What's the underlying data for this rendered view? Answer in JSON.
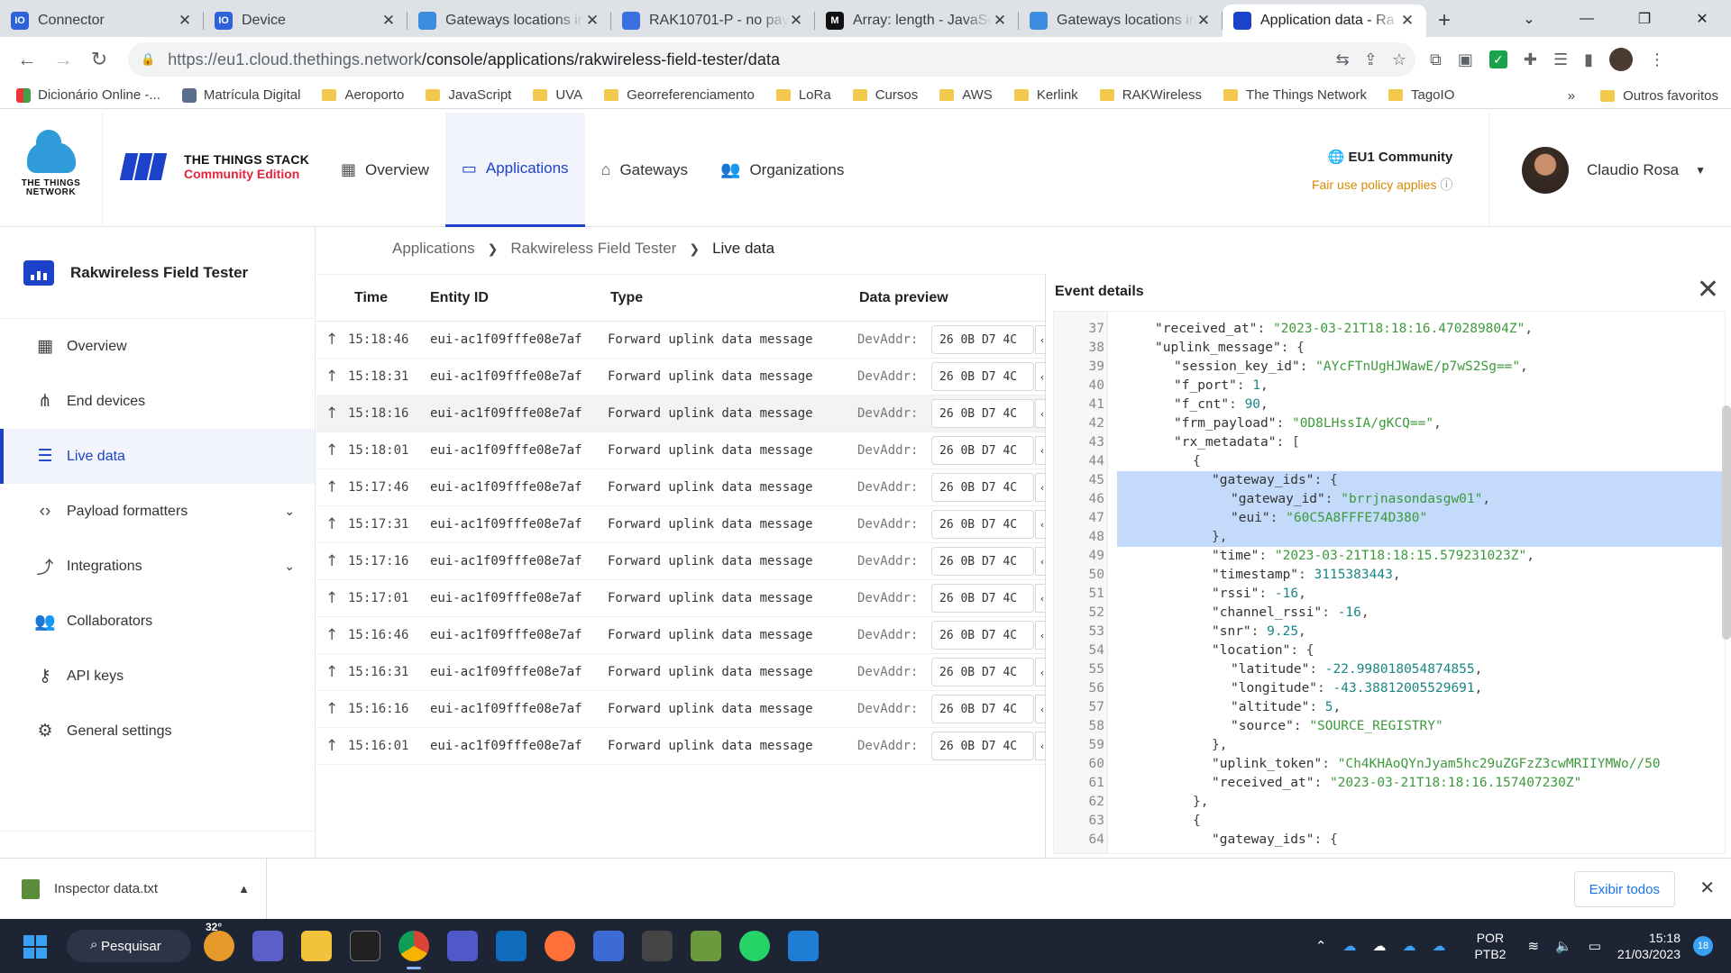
{
  "browser": {
    "tabs": [
      {
        "title": "Connector",
        "favicon_color": "#2e62d9",
        "favicon_text": "IO"
      },
      {
        "title": "Device",
        "favicon_color": "#2e62d9",
        "favicon_text": "IO"
      },
      {
        "title": "Gateways locations in",
        "favicon_color": "#3c8de0",
        "favicon_text": ""
      },
      {
        "title": "RAK10701-P - no pay",
        "favicon_color": "#3a6fe0",
        "favicon_text": ""
      },
      {
        "title": "Array: length - JavaSc",
        "favicon_color": "#111111",
        "favicon_text": "M"
      },
      {
        "title": "Gateways locations in",
        "favicon_color": "#3c8de0",
        "favicon_text": ""
      },
      {
        "title": "Application data - Ra",
        "favicon_color": "#1b42c9",
        "favicon_text": ""
      }
    ],
    "new_tab_label": "+",
    "url_prefix": "https://eu1.cloud.thethings.network",
    "url_path": "/console/applications/rakwireless-field-tester/data",
    "bookmarks": [
      "Dicionário Online -...",
      "Matrícula Digital",
      "Aeroporto",
      "JavaScript",
      "UVA",
      "Georreferenciamento",
      "LoRa",
      "Cursos",
      "AWS",
      "Kerlink",
      "RAKWireless",
      "The Things Network",
      "TagoIO"
    ],
    "bookmarks_more": "»",
    "other_bookmarks": "Outros favoritos"
  },
  "header": {
    "logo_text": "THE THINGS NETWORK",
    "stack_title": "THE THINGS STACK",
    "stack_subtitle": "Community Edition",
    "nav": [
      {
        "label": "Overview",
        "icon": "grid-icon"
      },
      {
        "label": "Applications",
        "icon": "app-icon",
        "active": true
      },
      {
        "label": "Gateways",
        "icon": "gateway-icon"
      },
      {
        "label": "Organizations",
        "icon": "org-icon"
      }
    ],
    "region": "EU1 Community",
    "fair_use": "Fair use policy applies",
    "user_name": "Claudio Rosa"
  },
  "sidebar": {
    "app_name": "Rakwireless Field Tester",
    "items": [
      {
        "label": "Overview",
        "icon": "grid-icon"
      },
      {
        "label": "End devices",
        "icon": "devices-icon"
      },
      {
        "label": "Live data",
        "icon": "list-icon",
        "active": true
      },
      {
        "label": "Payload formatters",
        "icon": "code-icon",
        "expandable": true
      },
      {
        "label": "Integrations",
        "icon": "integration-icon",
        "expandable": true
      },
      {
        "label": "Collaborators",
        "icon": "people-icon"
      },
      {
        "label": "API keys",
        "icon": "key-icon"
      },
      {
        "label": "General settings",
        "icon": "gear-icon"
      }
    ]
  },
  "breadcrumb": [
    "Applications",
    "Rakwireless Field Tester",
    "Live data"
  ],
  "table": {
    "columns": [
      "Time",
      "Entity ID",
      "Type",
      "Data preview"
    ],
    "rows": [
      {
        "time": "15:18:46",
        "entity": "eui-ac1f09fffe08e7af",
        "type": "Forward uplink data message",
        "label": "DevAddr:",
        "value": "26 0B D7 4C"
      },
      {
        "time": "15:18:31",
        "entity": "eui-ac1f09fffe08e7af",
        "type": "Forward uplink data message",
        "label": "DevAddr:",
        "value": "26 0B D7 4C"
      },
      {
        "time": "15:18:16",
        "entity": "eui-ac1f09fffe08e7af",
        "type": "Forward uplink data message",
        "label": "DevAddr:",
        "value": "26 0B D7 4C",
        "selected": true
      },
      {
        "time": "15:18:01",
        "entity": "eui-ac1f09fffe08e7af",
        "type": "Forward uplink data message",
        "label": "DevAddr:",
        "value": "26 0B D7 4C"
      },
      {
        "time": "15:17:46",
        "entity": "eui-ac1f09fffe08e7af",
        "type": "Forward uplink data message",
        "label": "DevAddr:",
        "value": "26 0B D7 4C"
      },
      {
        "time": "15:17:31",
        "entity": "eui-ac1f09fffe08e7af",
        "type": "Forward uplink data message",
        "label": "DevAddr:",
        "value": "26 0B D7 4C"
      },
      {
        "time": "15:17:16",
        "entity": "eui-ac1f09fffe08e7af",
        "type": "Forward uplink data message",
        "label": "DevAddr:",
        "value": "26 0B D7 4C"
      },
      {
        "time": "15:17:01",
        "entity": "eui-ac1f09fffe08e7af",
        "type": "Forward uplink data message",
        "label": "DevAddr:",
        "value": "26 0B D7 4C"
      },
      {
        "time": "15:16:46",
        "entity": "eui-ac1f09fffe08e7af",
        "type": "Forward uplink data message",
        "label": "DevAddr:",
        "value": "26 0B D7 4C"
      },
      {
        "time": "15:16:31",
        "entity": "eui-ac1f09fffe08e7af",
        "type": "Forward uplink data message",
        "label": "DevAddr:",
        "value": "26 0B D7 4C"
      },
      {
        "time": "15:16:16",
        "entity": "eui-ac1f09fffe08e7af",
        "type": "Forward uplink data message",
        "label": "DevAddr:",
        "value": "26 0B D7 4C"
      },
      {
        "time": "15:16:01",
        "entity": "eui-ac1f09fffe08e7af",
        "type": "Forward uplink data message",
        "label": "DevAddr:",
        "value": "26 0B D7 4C"
      }
    ]
  },
  "event_details": {
    "title": "Event details",
    "lines": [
      {
        "n": "37",
        "indent": 1,
        "html": "<span class='k'>\"received_at\"</span><span class='p'>: </span><span class='s'>\"2023-03-21T18:18:16.470289804Z\"</span><span class='p'>,</span>"
      },
      {
        "n": "38",
        "indent": 1,
        "html": "<span class='k'>\"uplink_message\"</span><span class='p'>: {</span>"
      },
      {
        "n": "39",
        "indent": 2,
        "html": "<span class='k'>\"session_key_id\"</span><span class='p'>: </span><span class='s'>\"AYcFTnUgHJWawE/p7wS2Sg==\"</span><span class='p'>,</span>"
      },
      {
        "n": "40",
        "indent": 2,
        "html": "<span class='k'>\"f_port\"</span><span class='p'>: </span><span class='n'>1</span><span class='p'>,</span>"
      },
      {
        "n": "41",
        "indent": 2,
        "html": "<span class='k'>\"f_cnt\"</span><span class='p'>: </span><span class='n'>90</span><span class='p'>,</span>"
      },
      {
        "n": "42",
        "indent": 2,
        "html": "<span class='k'>\"frm_payload\"</span><span class='p'>: </span><span class='s'>\"0D8LHssIA/gKCQ==\"</span><span class='p'>,</span>"
      },
      {
        "n": "43",
        "indent": 2,
        "html": "<span class='k'>\"rx_metadata\"</span><span class='p'>: [</span>"
      },
      {
        "n": "44",
        "indent": 3,
        "html": "<span class='p'>{</span>"
      },
      {
        "n": "45",
        "indent": 4,
        "sel": true,
        "html": "<span class='k'>\"gateway_ids\"</span><span class='p'>: {</span>"
      },
      {
        "n": "46",
        "indent": 5,
        "sel": true,
        "html": "<span class='k'>\"gateway_id\"</span><span class='p'>: </span><span class='s'>\"brrjnasondasgw01\"</span><span class='p'>,</span>"
      },
      {
        "n": "47",
        "indent": 5,
        "sel": true,
        "html": "<span class='k'>\"eui\"</span><span class='p'>: </span><span class='s'>\"60C5A8FFFE74D380\"</span>"
      },
      {
        "n": "48",
        "indent": 4,
        "sel": true,
        "html": "<span class='p'>},</span>"
      },
      {
        "n": "49",
        "indent": 4,
        "html": "<span class='k'>\"time\"</span><span class='p'>: </span><span class='s'>\"2023-03-21T18:18:15.579231023Z\"</span><span class='p'>,</span>"
      },
      {
        "n": "50",
        "indent": 4,
        "html": "<span class='k'>\"timestamp\"</span><span class='p'>: </span><span class='n'>3115383443</span><span class='p'>,</span>"
      },
      {
        "n": "51",
        "indent": 4,
        "html": "<span class='k'>\"rssi\"</span><span class='p'>: </span><span class='n'>-16</span><span class='p'>,</span>"
      },
      {
        "n": "52",
        "indent": 4,
        "html": "<span class='k'>\"channel_rssi\"</span><span class='p'>: </span><span class='n'>-16</span><span class='p'>,</span>"
      },
      {
        "n": "53",
        "indent": 4,
        "html": "<span class='k'>\"snr\"</span><span class='p'>: </span><span class='n'>9.25</span><span class='p'>,</span>"
      },
      {
        "n": "54",
        "indent": 4,
        "html": "<span class='k'>\"location\"</span><span class='p'>: {</span>"
      },
      {
        "n": "55",
        "indent": 5,
        "html": "<span class='k'>\"latitude\"</span><span class='p'>: </span><span class='n'>-22.998018054874855</span><span class='p'>,</span>"
      },
      {
        "n": "56",
        "indent": 5,
        "html": "<span class='k'>\"longitude\"</span><span class='p'>: </span><span class='n'>-43.38812005529691</span><span class='p'>,</span>"
      },
      {
        "n": "57",
        "indent": 5,
        "html": "<span class='k'>\"altitude\"</span><span class='p'>: </span><span class='n'>5</span><span class='p'>,</span>"
      },
      {
        "n": "58",
        "indent": 5,
        "html": "<span class='k'>\"source\"</span><span class='p'>: </span><span class='s'>\"SOURCE_REGISTRY\"</span>"
      },
      {
        "n": "59",
        "indent": 4,
        "html": "<span class='p'>},</span>"
      },
      {
        "n": "60",
        "indent": 4,
        "html": "<span class='k'>\"uplink_token\"</span><span class='p'>: </span><span class='s'>\"Ch4KHAoQYnJyam5hc29uZGFzZ3cwMRIIYMWo//50</span>"
      },
      {
        "n": "61",
        "indent": 4,
        "html": "<span class='k'>\"received_at\"</span><span class='p'>: </span><span class='s'>\"2023-03-21T18:18:16.157407230Z\"</span>"
      },
      {
        "n": "62",
        "indent": 3,
        "html": "<span class='p'>},</span>"
      },
      {
        "n": "63",
        "indent": 3,
        "html": "<span class='p'>{</span>"
      },
      {
        "n": "64",
        "indent": 4,
        "html": "<span class='k'>\"gateway_ids\"</span><span class='p'>: {</span>"
      }
    ]
  },
  "downloads": {
    "file": "Inspector data.txt",
    "show_all": "Exibir todos"
  },
  "taskbar": {
    "search": "Pesquisar",
    "weather": "32°",
    "lang": "POR",
    "layout": "PTB2",
    "time": "15:18",
    "date": "21/03/2023",
    "notifications": "18"
  }
}
